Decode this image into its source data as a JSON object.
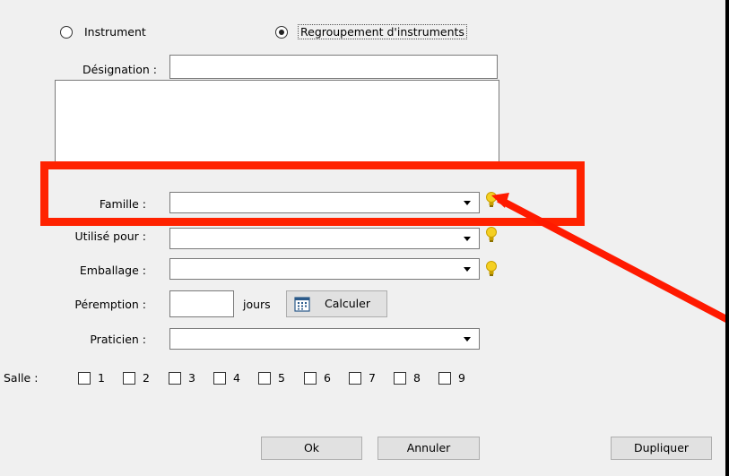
{
  "radios": {
    "instrument_label": "Instrument",
    "regroupement_label": "Regroupement d'instruments",
    "selected": "regroupement"
  },
  "labels": {
    "designation": "Désignation :",
    "famille": "Famille :",
    "utilise_pour": "Utilisé pour :",
    "emballage": "Emballage :",
    "peremption": "Péremption :",
    "jours": "jours",
    "praticien": "Praticien :",
    "salle": "Salle :"
  },
  "fields": {
    "designation_value": "",
    "description_value": "",
    "famille_value": "",
    "utilise_pour_value": "",
    "emballage_value": "",
    "peremption_value": "",
    "praticien_value": ""
  },
  "buttons": {
    "calculer": "Calculer",
    "ok": "Ok",
    "annuler": "Annuler",
    "dupliquer": "Dupliquer"
  },
  "salles": [
    "1",
    "2",
    "3",
    "4",
    "5",
    "6",
    "7",
    "8",
    "9"
  ],
  "icons": {
    "hint": "lightbulb-icon",
    "calendar": "calendar-icon",
    "dropdown": "chevron-down-icon"
  },
  "annotation": {
    "highlight_color": "#ff2200",
    "arrow_color": "#ff1a00"
  }
}
